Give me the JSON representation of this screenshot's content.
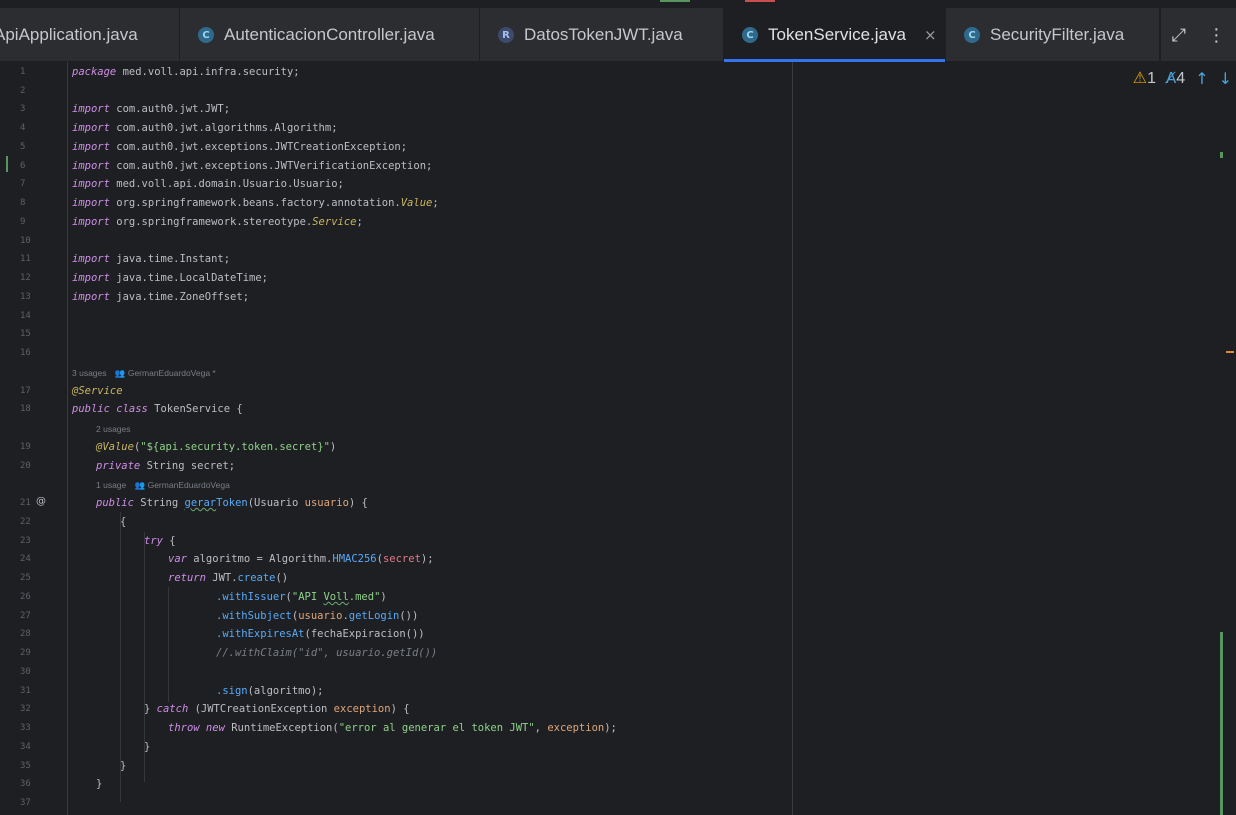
{
  "tabs": [
    {
      "label": "ApiApplication.java",
      "icon": "class-icon"
    },
    {
      "label": "AutenticacionController.java",
      "icon": "class-icon"
    },
    {
      "label": "DatosTokenJWT.java",
      "icon": "record-icon"
    },
    {
      "label": "TokenService.java",
      "icon": "class-icon",
      "active": true,
      "close": "×"
    },
    {
      "label": "SecurityFilter.java",
      "icon": "class-icon"
    }
  ],
  "toolbar": {
    "maximize_icon": "maximize-icon",
    "more_icon": "more-vertical-icon"
  },
  "inspections": {
    "warnings": "1",
    "typos": "4"
  },
  "hints": {
    "class_usages": "3 usages",
    "class_author": "GermanEduardoVega *",
    "field_usages": "2 usages",
    "method_usages": "1 usage",
    "method_author": "GermanEduardoVega"
  },
  "line_numbers": [
    "1",
    "2",
    "3",
    "4",
    "5",
    "6",
    "7",
    "8",
    "9",
    "10",
    "11",
    "12",
    "13",
    "14",
    "15",
    "16",
    "17",
    "18",
    "19",
    "20",
    "21",
    "22",
    "23",
    "24",
    "25",
    "26",
    "27",
    "28",
    "29",
    "30",
    "31",
    "32",
    "33",
    "34",
    "35",
    "36",
    "37"
  ],
  "gutter_marker": "@",
  "code": {
    "l1_kw": "package",
    "l1_rest": " med.voll.api.infra.security;",
    "imp": "import",
    "l3": " com.auth0.jwt.JWT;",
    "l4": " com.auth0.jwt.algorithms.Algorithm;",
    "l5": " com.auth0.jwt.exceptions.JWTCreationException;",
    "l6": " com.auth0.jwt.exceptions.JWTVerificationException;",
    "l7": " med.voll.api.domain.Usuario.Usuario;",
    "l8a": " org.springframework.beans.factory.annotation.",
    "l8b": "Value",
    "l8c": ";",
    "l9a": " org.springframework.stereotype.",
    "l9b": "Service",
    "l9c": ";",
    "l11": " java.time.Instant;",
    "l12": " java.time.LocalDateTime;",
    "l13": " java.time.ZoneOffset;",
    "l17": "@Service",
    "l18_kw": "public class",
    "l18_rest": " TokenService {",
    "l19_ann": "@Value",
    "l19_p1": "(",
    "l19_str": "\"${api.security.token.secret}\"",
    "l19_p2": ")",
    "l20_kw": "private",
    "l20_rest": " String secret;",
    "l21_kw": "public",
    "l21_t": " String ",
    "l21_fn1": "gerar",
    "l21_fn2": "Token",
    "l21_p": "(Usuario ",
    "l21_prm": "usuario",
    "l21_end": ") {",
    "l22": "{",
    "l23_kw": "try",
    "l23_rest": " {",
    "l24_kw": "var",
    "l24_a": " algoritmo = Algorithm.",
    "l24_fn": "HMAC256",
    "l24_b": "(",
    "l24_fld": "secret",
    "l24_c": ");",
    "l25_kw": "return",
    "l25_a": " JWT.",
    "l25_fn": "create",
    "l25_b": "()",
    "l26_fn": ".withIssuer",
    "l26_a": "(",
    "l26_s1": "\"API ",
    "l26_s2": "Voll",
    "l26_s3": ".med\"",
    "l26_b": ")",
    "l27_fn": ".withSubject",
    "l27_a": "(",
    "l27_prm": "usuario",
    "l27_dot": ".",
    "l27_fn2": "getLogin",
    "l27_b": "())",
    "l28_fn": ".withExpiresAt",
    "l28_a": "(fechaExpiracion())",
    "l29": "//.withClaim(\"id\", usuario.getId())",
    "l31_fn": ".sign",
    "l31_a": "(algoritmo);",
    "l32_a": "} ",
    "l32_kw": "catch",
    "l32_b": " (JWTCreationException ",
    "l32_prm": "exception",
    "l32_c": ") {",
    "l33_kw": "throw new",
    "l33_a": " RuntimeException(",
    "l33_str": "\"error al generar el token JWT\"",
    "l33_b": ", ",
    "l33_prm": "exception",
    "l33_c": ");",
    "l34": "}",
    "l35": "}",
    "l36": "}"
  }
}
